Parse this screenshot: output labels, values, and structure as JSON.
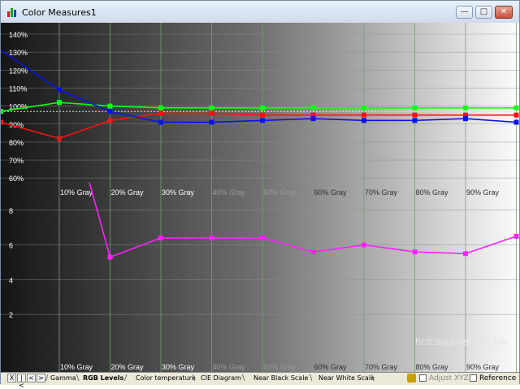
{
  "window": {
    "title": "Color Measures1"
  },
  "icons": {
    "app": "bar-chart-icon",
    "minimize": "minimize-icon",
    "maximize": "maximize-icon",
    "close": "close-icon"
  },
  "colors": {
    "red": "#ff1010",
    "green": "#10ff10",
    "blue": "#0a14e6",
    "delta_e": "#ff20ff",
    "grid": "#7f9a7f"
  },
  "chart_data": [
    {
      "type": "line",
      "title": "",
      "x_labels": [
        "10% Gray",
        "20% Gray",
        "30% Gray",
        "40% Gray",
        "50% Gray",
        "60% Gray",
        "70% Gray",
        "80% Gray",
        "90% Gray"
      ],
      "y_tick_labels": [
        "140%",
        "130%",
        "120%",
        "110%",
        "100%",
        "90%",
        "80%",
        "70%",
        "60%"
      ],
      "ylim": [
        55,
        145
      ],
      "reference_line": 97,
      "series": [
        {
          "color": "red",
          "values": [
            91,
            82,
            92,
            96,
            96,
            95,
            95,
            95,
            95,
            95,
            95
          ]
        },
        {
          "color": "green",
          "values": [
            97,
            102,
            100,
            99,
            99,
            99,
            99,
            99,
            99,
            99,
            99
          ]
        },
        {
          "color": "blue",
          "values": [
            131,
            109,
            97,
            91,
            91,
            92,
            93,
            92,
            92,
            93,
            91
          ]
        }
      ]
    },
    {
      "type": "line",
      "title": "",
      "x_labels": [
        "10% Gray",
        "20% Gray",
        "30% Gray",
        "40% Gray",
        "50% Gray",
        "60% Gray",
        "70% Gray",
        "80% Gray",
        "90% Gray"
      ],
      "y_tick_labels": [
        "8",
        "6",
        "4",
        "2"
      ],
      "ylim": [
        0,
        10
      ],
      "series": [
        {
          "color": "delta_e",
          "values": [
            9.6,
            5.3,
            6.4,
            6.4,
            6.4,
            5.6,
            6.0,
            5.6,
            5.5,
            6.5
          ]
        }
      ]
    }
  ],
  "watermark": "hcfr.sourceforge.net",
  "tabs": [
    "Gamma",
    "RGB Levels",
    "Color temperature",
    "CIE Diagram",
    "Near Black Scale",
    "Near White Scale"
  ],
  "active_tab": "RGB Levels",
  "nav_buttons": [
    "X",
    "|<",
    "<",
    ">"
  ],
  "status": {
    "adjust_xyz_label": "Adjust XYZ",
    "reference_label": "Reference"
  }
}
